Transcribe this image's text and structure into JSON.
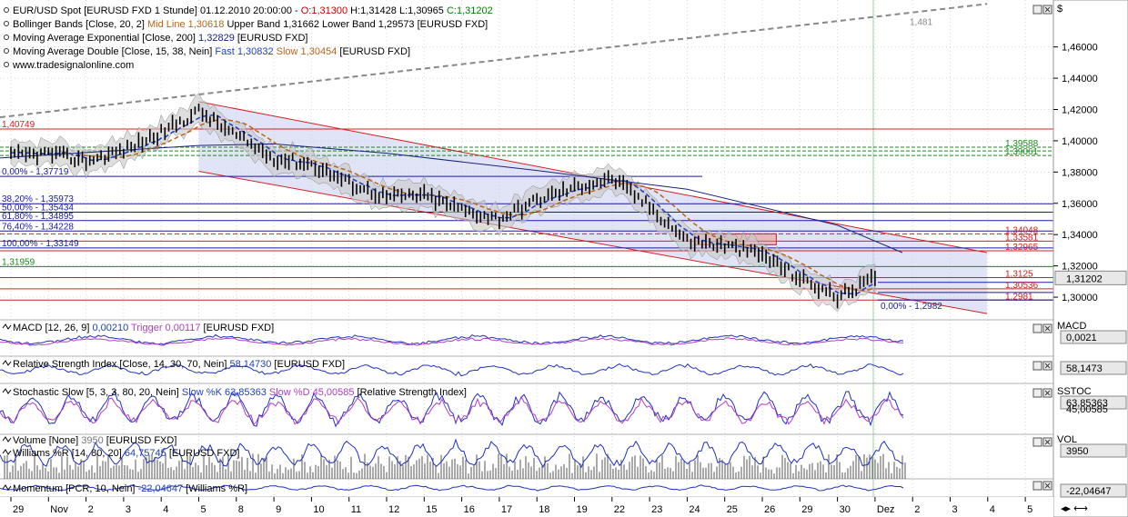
{
  "colors": {
    "price": "#000000",
    "bollinger_fill": "#c8c8c8",
    "ema": "#1a237e",
    "fast_ma": "#1f3fbf",
    "slow_ma": "#b8651a",
    "channel_fill": "#c8cdf0",
    "red_line": "#d32020",
    "green_line": "#1a8a1a",
    "fib_blue": "#1a1aa0",
    "indicator": "#2030c0",
    "volume": "#555555"
  },
  "main": {
    "legend": [
      {
        "prefix": "EUR/USD Spot [EURUSD FXD  1 Stunde] 01.12.2010 20:00:00 - ",
        "parts": [
          {
            "t": "O:1,31300",
            "c": "#c00000"
          },
          {
            "t": " H:1,31428 L:1,30965 ",
            "c": "#000000"
          },
          {
            "t": "C:1,31202",
            "c": "#008000"
          }
        ]
      },
      {
        "prefix": "Bollinger Bands [Close, 20, 2] ",
        "parts": [
          {
            "t": "Mid Line 1,30618",
            "c": "#b8651a"
          },
          {
            "t": " Upper Band 1,31662 Lower Band 1,29573 [EURUSD FXD]",
            "c": "#000000"
          }
        ]
      },
      {
        "prefix": "Moving Average Exponential [Close, 200] ",
        "parts": [
          {
            "t": "1,32829",
            "c": "#1a237e"
          },
          {
            "t": " [EURUSD FXD]",
            "c": "#000000"
          }
        ]
      },
      {
        "prefix": "Moving Average Double [Close, 15, 38, Nein] ",
        "parts": [
          {
            "t": "Fast 1,30832",
            "c": "#1f3fbf"
          },
          {
            "t": " ",
            "c": "#000"
          },
          {
            "t": "Slow 1,30454",
            "c": "#b8651a"
          },
          {
            "t": " [EURUSD FXD]",
            "c": "#000000"
          }
        ]
      },
      {
        "prefix": "www.tradesignalonline.com",
        "parts": []
      }
    ],
    "axis_unit": "$",
    "y_ticks": [
      "1,46000",
      "1,44000",
      "1,42000",
      "1,40000",
      "1,38000",
      "1,36000",
      "1,34000",
      "1,32000",
      "1,30000"
    ],
    "current_price": "1,31202",
    "top_label": "1,481",
    "levels_left": [
      {
        "text": "1,40749",
        "color": "#d32020"
      },
      {
        "text": "0,00% - 1,37719",
        "color": "#1a1aa0"
      },
      {
        "text": "38,20% - 1,35973",
        "color": "#1a1aa0"
      },
      {
        "text": "50,00% - 1,35434",
        "color": "#1a1aa0"
      },
      {
        "text": "61,80% - 1,34895",
        "color": "#1a1aa0"
      },
      {
        "text": "76,40% - 1,34228",
        "color": "#1a1aa0"
      },
      {
        "text": "100,00% - 1,33149",
        "color": "#1a1aa0"
      },
      {
        "text": "1,31959",
        "color": "#1a8a1a"
      }
    ],
    "levels_right": [
      {
        "text": "1,39588",
        "color": "#1a8a1a"
      },
      {
        "text": "1,39061",
        "color": "#1a8a1a"
      },
      {
        "text": "1,34048",
        "color": "#d32020"
      },
      {
        "text": "1,33581",
        "color": "#d32020"
      },
      {
        "text": "1,32965",
        "color": "#d32020"
      },
      {
        "text": "1,3125",
        "color": "#d32020"
      },
      {
        "text": "1,30536",
        "color": "#d32020"
      },
      {
        "text": "1,2981",
        "color": "#d32020"
      },
      {
        "text": "0,00% - 1,2982",
        "color": "#1a1aa0"
      }
    ]
  },
  "panes": {
    "macd": {
      "label": "MACD [12, 26, 9] ",
      "parts": [
        {
          "t": "0,00210",
          "c": "#1f3fbf"
        },
        {
          "t": " Trigger 0,00117",
          "c": "#b040c0"
        },
        {
          "t": " [EURUSD FXD]",
          "c": "#000"
        }
      ],
      "axis_name": "MACD",
      "value": "0,0021"
    },
    "rsi": {
      "label": "Relative Strength Index [Close, 14, 30, 70, Nein] ",
      "parts": [
        {
          "t": "58,14730",
          "c": "#1f3fbf"
        },
        {
          "t": " [EURUSD FXD]",
          "c": "#000"
        }
      ],
      "axis_name": "",
      "value": "58,1473"
    },
    "stoch": {
      "label": "Stochastic Slow [5, 3, 3, 80, 20, Nein] ",
      "parts": [
        {
          "t": "Slow %K 63,85363",
          "c": "#1f3fbf"
        },
        {
          "t": " Slow %D 45,00585",
          "c": "#b040c0"
        },
        {
          "t": " [Relative Strength Index]",
          "c": "#000"
        }
      ],
      "axis_name": "SSTOC",
      "value": "63,85363",
      "value2": "45,00585"
    },
    "vol": {
      "label": "Volume [None] ",
      "parts": [
        {
          "t": "3950",
          "c": "#777"
        },
        {
          "t": " [EURUSD FXD]",
          "c": "#000"
        }
      ],
      "label2": "Williams %R [14, 80, 20] ",
      "parts2": [
        {
          "t": "64,75745",
          "c": "#1f3fbf"
        },
        {
          "t": " [EURUSD FXD]",
          "c": "#000"
        }
      ],
      "axis_name": "VOL",
      "value": "3950"
    },
    "mom": {
      "label": "Momentum [PCR, 10, Nein] ",
      "parts": [
        {
          "t": "-22,04647",
          "c": "#1f3fbf"
        },
        {
          "t": " [Williams %R]",
          "c": "#000"
        }
      ],
      "axis_name": "",
      "value": "-22,04647"
    }
  },
  "x_axis": [
    "29",
    "Nov",
    "2",
    "3",
    "4",
    "5",
    "8",
    "9",
    "10",
    "11",
    "12",
    "15",
    "16",
    "17",
    "18",
    "19",
    "22",
    "23",
    "24",
    "25",
    "26",
    "29",
    "30",
    "Dez",
    "2",
    "3",
    "4",
    "5"
  ],
  "chart_data": {
    "type": "line",
    "title": "EUR/USD Spot [EURUSD FXD  1 Stunde]",
    "ylabel": "$",
    "ylim": [
      1.2855,
      1.49
    ],
    "categories": [
      "29",
      "Nov",
      "2",
      "3",
      "4",
      "5",
      "8",
      "9",
      "10",
      "11",
      "12",
      "15",
      "16",
      "17",
      "18",
      "19",
      "22",
      "23",
      "24",
      "25",
      "26",
      "29",
      "30",
      "Dez",
      "2",
      "3",
      "4",
      "5"
    ],
    "series": [
      {
        "name": "EUR/USD Spot [EURUSD FXD  1 Stunde]",
        "x": [
          0,
          1,
          2,
          3,
          4,
          5,
          6,
          7,
          8,
          9,
          10,
          11,
          12,
          13,
          14,
          15,
          16,
          17,
          18,
          19,
          20,
          21,
          22,
          23
        ],
        "values": [
          1.39,
          1.392,
          1.387,
          1.394,
          1.405,
          1.419,
          1.403,
          1.389,
          1.385,
          1.373,
          1.364,
          1.365,
          1.356,
          1.35,
          1.362,
          1.37,
          1.376,
          1.358,
          1.336,
          1.333,
          1.327,
          1.312,
          1.3,
          1.312
        ]
      }
    ],
    "annotations": [
      "1,481",
      "1,40749",
      "0,00% - 1,37719",
      "38,20% - 1,35973",
      "50,00% - 1,35434",
      "61,80% - 1,34895",
      "76,40% - 1,34228",
      "100,00% - 1,33149",
      "1,31959",
      "1,39588",
      "1,39061",
      "1,34048",
      "1,33581",
      "1,32965",
      "1,3125",
      "1,30536",
      "1,2981",
      "0,00% - 1,2982"
    ]
  }
}
